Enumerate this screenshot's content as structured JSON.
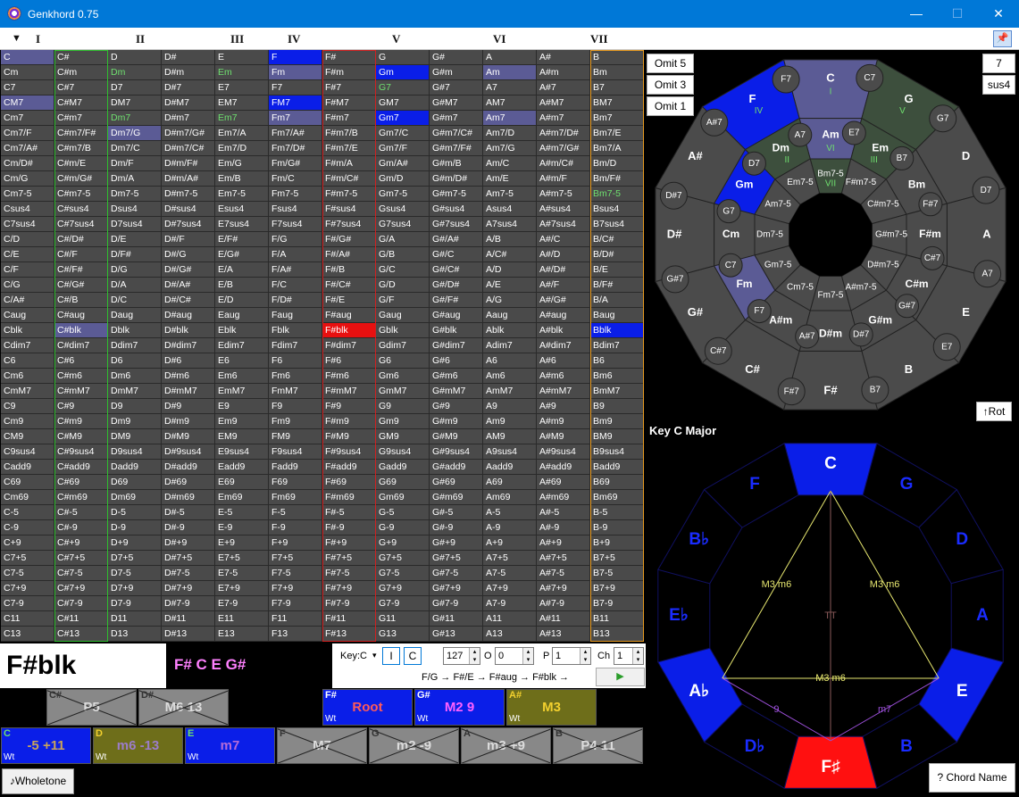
{
  "window": {
    "title": "Genkhord 0.75",
    "minimize": "—",
    "maximize": "☐",
    "close": "✕"
  },
  "toolbar": {
    "arrow": "▼",
    "numerals": [
      "I",
      "II",
      "III",
      "IV",
      "V",
      "VI",
      "VII"
    ],
    "pin": "📌"
  },
  "grid": {
    "roots": [
      "C",
      "C#",
      "D",
      "D#",
      "E",
      "F",
      "F#",
      "G",
      "G#",
      "A",
      "A#",
      "B"
    ],
    "suffixes": [
      "",
      "m",
      "7",
      "M7",
      "m7",
      "7/F",
      "m7/B",
      "m7/G",
      "m7/C",
      "m7/D",
      "m7-5",
      "sus4",
      "7sus4",
      "/D",
      "/E",
      "/F",
      "/G",
      "/B",
      "aug",
      "blk",
      "dim7",
      "6",
      "m6",
      "mM7",
      "9",
      "m9",
      "M9",
      "9sus4",
      "add9",
      "69",
      "m69",
      "-5",
      "-9",
      "+9",
      "7+5",
      "7-5",
      "7+9",
      "7-9",
      "11",
      "13"
    ],
    "cells": [
      [
        "C",
        "C#",
        "D",
        "D#",
        "E",
        "F",
        "F#",
        "G",
        "G#",
        "A",
        "A#",
        "B"
      ],
      [
        "Cm",
        "C#m",
        "Dm",
        "D#m",
        "Em",
        "Fm",
        "F#m",
        "Gm",
        "G#m",
        "Am",
        "A#m",
        "Bm"
      ],
      [
        "C7",
        "C#7",
        "D7",
        "D#7",
        "E7",
        "F7",
        "F#7",
        "G7",
        "G#7",
        "A7",
        "A#7",
        "B7"
      ],
      [
        "CM7",
        "C#M7",
        "DM7",
        "D#M7",
        "EM7",
        "FM7",
        "F#M7",
        "GM7",
        "G#M7",
        "AM7",
        "A#M7",
        "BM7"
      ],
      [
        "Cm7",
        "C#m7",
        "Dm7",
        "D#m7",
        "Em7",
        "Fm7",
        "F#m7",
        "Gm7",
        "G#m7",
        "Am7",
        "A#m7",
        "Bm7"
      ],
      [
        "Cm7/F",
        "C#m7/F#",
        "Dm7/G",
        "D#m7/G#",
        "Em7/A",
        "Fm7/A#",
        "F#m7/B",
        "Gm7/C",
        "G#m7/C#",
        "Am7/D",
        "A#m7/D#",
        "Bm7/E"
      ],
      [
        "Cm7/A#",
        "C#m7/B",
        "Dm7/C",
        "D#m7/C#",
        "Em7/D",
        "Fm7/D#",
        "F#m7/E",
        "Gm7/F",
        "G#m7/F#",
        "Am7/G",
        "A#m7/G#",
        "Bm7/A"
      ],
      [
        "Cm/D#",
        "C#m/E",
        "Dm/F",
        "D#m/F#",
        "Em/G",
        "Fm/G#",
        "F#m/A",
        "Gm/A#",
        "G#m/B",
        "Am/C",
        "A#m/C#",
        "Bm/D"
      ],
      [
        "Cm/G",
        "C#m/G#",
        "Dm/A",
        "D#m/A#",
        "Em/B",
        "Fm/C",
        "F#m/C#",
        "Gm/D",
        "G#m/D#",
        "Am/E",
        "A#m/F",
        "Bm/F#"
      ],
      [
        "Cm7-5",
        "C#m7-5",
        "Dm7-5",
        "D#m7-5",
        "Em7-5",
        "Fm7-5",
        "F#m7-5",
        "Gm7-5",
        "G#m7-5",
        "Am7-5",
        "A#m7-5",
        "Bm7-5"
      ],
      [
        "Csus4",
        "C#sus4",
        "Dsus4",
        "D#sus4",
        "Esus4",
        "Fsus4",
        "F#sus4",
        "Gsus4",
        "G#sus4",
        "Asus4",
        "A#sus4",
        "Bsus4"
      ],
      [
        "C7sus4",
        "C#7sus4",
        "D7sus4",
        "D#7sus4",
        "E7sus4",
        "F7sus4",
        "F#7sus4",
        "G7sus4",
        "G#7sus4",
        "A7sus4",
        "A#7sus4",
        "B7sus4"
      ],
      [
        "C/D",
        "C#/D#",
        "D/E",
        "D#/F",
        "E/F#",
        "F/G",
        "F#/G#",
        "G/A",
        "G#/A#",
        "A/B",
        "A#/C",
        "B/C#"
      ],
      [
        "C/E",
        "C#/F",
        "D/F#",
        "D#/G",
        "E/G#",
        "F/A",
        "F#/A#",
        "G/B",
        "G#/C",
        "A/C#",
        "A#/D",
        "B/D#"
      ],
      [
        "C/F",
        "C#/F#",
        "D/G",
        "D#/G#",
        "E/A",
        "F/A#",
        "F#/B",
        "G/C",
        "G#/C#",
        "A/D",
        "A#/D#",
        "B/E"
      ],
      [
        "C/G",
        "C#/G#",
        "D/A",
        "D#/A#",
        "E/B",
        "F/C",
        "F#/C#",
        "G/D",
        "G#/D#",
        "A/E",
        "A#/F",
        "B/F#"
      ],
      [
        "C/A#",
        "C#/B",
        "D/C",
        "D#/C#",
        "E/D",
        "F/D#",
        "F#/E",
        "G/F",
        "G#/F#",
        "A/G",
        "A#/G#",
        "B/A"
      ],
      [
        "Caug",
        "C#aug",
        "Daug",
        "D#aug",
        "Eaug",
        "Faug",
        "F#aug",
        "Gaug",
        "G#aug",
        "Aaug",
        "A#aug",
        "Baug"
      ],
      [
        "Cblk",
        "C#blk",
        "Dblk",
        "D#blk",
        "Eblk",
        "Fblk",
        "F#blk",
        "Gblk",
        "G#blk",
        "Ablk",
        "A#blk",
        "Bblk"
      ],
      [
        "Cdim7",
        "C#dim7",
        "Ddim7",
        "D#dim7",
        "Edim7",
        "Fdim7",
        "F#dim7",
        "Gdim7",
        "G#dim7",
        "Adim7",
        "A#dim7",
        "Bdim7"
      ],
      [
        "C6",
        "C#6",
        "D6",
        "D#6",
        "E6",
        "F6",
        "F#6",
        "G6",
        "G#6",
        "A6",
        "A#6",
        "B6"
      ],
      [
        "Cm6",
        "C#m6",
        "Dm6",
        "D#m6",
        "Em6",
        "Fm6",
        "F#m6",
        "Gm6",
        "G#m6",
        "Am6",
        "A#m6",
        "Bm6"
      ],
      [
        "CmM7",
        "C#mM7",
        "DmM7",
        "D#mM7",
        "EmM7",
        "FmM7",
        "F#mM7",
        "GmM7",
        "G#mM7",
        "AmM7",
        "A#mM7",
        "BmM7"
      ],
      [
        "C9",
        "C#9",
        "D9",
        "D#9",
        "E9",
        "F9",
        "F#9",
        "G9",
        "G#9",
        "A9",
        "A#9",
        "B9"
      ],
      [
        "Cm9",
        "C#m9",
        "Dm9",
        "D#m9",
        "Em9",
        "Fm9",
        "F#m9",
        "Gm9",
        "G#m9",
        "Am9",
        "A#m9",
        "Bm9"
      ],
      [
        "CM9",
        "C#M9",
        "DM9",
        "D#M9",
        "EM9",
        "FM9",
        "F#M9",
        "GM9",
        "G#M9",
        "AM9",
        "A#M9",
        "BM9"
      ],
      [
        "C9sus4",
        "C#9sus4",
        "D9sus4",
        "D#9sus4",
        "E9sus4",
        "F9sus4",
        "F#9sus4",
        "G9sus4",
        "G#9sus4",
        "A9sus4",
        "A#9sus4",
        "B9sus4"
      ],
      [
        "Cadd9",
        "C#add9",
        "Dadd9",
        "D#add9",
        "Eadd9",
        "Fadd9",
        "F#add9",
        "Gadd9",
        "G#add9",
        "Aadd9",
        "A#add9",
        "Badd9"
      ],
      [
        "C69",
        "C#69",
        "D69",
        "D#69",
        "E69",
        "F69",
        "F#69",
        "G69",
        "G#69",
        "A69",
        "A#69",
        "B69"
      ],
      [
        "Cm69",
        "C#m69",
        "Dm69",
        "D#m69",
        "Em69",
        "Fm69",
        "F#m69",
        "Gm69",
        "G#m69",
        "Am69",
        "A#m69",
        "Bm69"
      ],
      [
        "C-5",
        "C#-5",
        "D-5",
        "D#-5",
        "E-5",
        "F-5",
        "F#-5",
        "G-5",
        "G#-5",
        "A-5",
        "A#-5",
        "B-5"
      ],
      [
        "C-9",
        "C#-9",
        "D-9",
        "D#-9",
        "E-9",
        "F-9",
        "F#-9",
        "G-9",
        "G#-9",
        "A-9",
        "A#-9",
        "B-9"
      ],
      [
        "C+9",
        "C#+9",
        "D+9",
        "D#+9",
        "E+9",
        "F+9",
        "F#+9",
        "G+9",
        "G#+9",
        "A+9",
        "A#+9",
        "B+9"
      ],
      [
        "C7+5",
        "C#7+5",
        "D7+5",
        "D#7+5",
        "E7+5",
        "F7+5",
        "F#7+5",
        "G7+5",
        "G#7+5",
        "A7+5",
        "A#7+5",
        "B7+5"
      ],
      [
        "C7-5",
        "C#7-5",
        "D7-5",
        "D#7-5",
        "E7-5",
        "F7-5",
        "F#7-5",
        "G7-5",
        "G#7-5",
        "A7-5",
        "A#7-5",
        "B7-5"
      ],
      [
        "C7+9",
        "C#7+9",
        "D7+9",
        "D#7+9",
        "E7+9",
        "F7+9",
        "F#7+9",
        "G7+9",
        "G#7+9",
        "A7+9",
        "A#7+9",
        "B7+9"
      ],
      [
        "C7-9",
        "C#7-9",
        "D7-9",
        "D#7-9",
        "E7-9",
        "F7-9",
        "F#7-9",
        "G7-9",
        "G#7-9",
        "A7-9",
        "A#7-9",
        "B7-9"
      ],
      [
        "C11",
        "C#11",
        "D11",
        "D#11",
        "E11",
        "F11",
        "F#11",
        "G11",
        "G#11",
        "A11",
        "A#11",
        "B11"
      ],
      [
        "C13",
        "C#13",
        "D13",
        "D#13",
        "E13",
        "F13",
        "F#13",
        "G13",
        "G#13",
        "A13",
        "A#13",
        "B13"
      ]
    ],
    "highlights": {
      "0-0": "#5b5b95",
      "0-5": "#0a1ee8",
      "1-5": "#5b5b95",
      "1-7": "#0a1ee8",
      "1-9": "#5b5b95",
      "3-0": "#5b5b95",
      "3-5": "#0a1ee8",
      "4-5": "#5b5b95",
      "4-7": "#0a1ee8",
      "4-9": "#5b5b95",
      "5-2": "#5b5b95",
      "18-1": "#5b5b95",
      "18-6": "#e81010",
      "18-11": "#0a1ee8"
    },
    "greenText": [
      "1-2",
      "1-4",
      "2-7",
      "4-2",
      "4-4",
      "9-11"
    ],
    "colBorders": {
      "1": "#2ebd2e",
      "6": "#d02020",
      "11": "#e89a20"
    }
  },
  "selected": {
    "chord": "F#blk",
    "notes": "F# C E G#"
  },
  "controls": {
    "key_label": "Key:C",
    "key_arrow": "▾",
    "btn_I": "I",
    "btn_C": "C",
    "velocity": "127",
    "o_label": "O",
    "octave": "0",
    "p_label": "P",
    "program": "1",
    "ch_label": "Ch",
    "channel": "1",
    "progression": "F/G → F#/E → F#aug → F#blk →",
    "play": "▶"
  },
  "intervals_top": [
    {
      "note": "C#",
      "name": "P5",
      "wt": "",
      "color": "#888888",
      "crossed": true
    },
    {
      "note": "D#",
      "name": "M6 13",
      "wt": "",
      "color": "#888888",
      "crossed": true
    },
    {
      "note": "F#",
      "name": "Root",
      "wt": "Wt",
      "color": "#0a1ee8",
      "nameColor": "#ff5a5a"
    },
    {
      "note": "G#",
      "name": "M2 9",
      "wt": "Wt",
      "color": "#0a1ee8",
      "nameColor": "#ff60ff"
    },
    {
      "note": "A#",
      "name": "M3",
      "wt": "Wt",
      "color": "#6e6e1a",
      "nameColor": "#f2d02e"
    }
  ],
  "intervals_bottom": [
    {
      "note": "C",
      "name": "-5 +11",
      "wt": "Wt",
      "color": "#0a1ee8",
      "nameColor": "#c9a45a"
    },
    {
      "note": "D",
      "name": "m6 -13",
      "wt": "Wt",
      "color": "#6e6e1a",
      "nameColor": "#9b7dc8"
    },
    {
      "note": "E",
      "name": "m7",
      "wt": "Wt",
      "color": "#0a1ee8",
      "nameColor": "#b56bd8"
    },
    {
      "note": "F",
      "name": "M7",
      "wt": "",
      "color": "#888888",
      "crossed": true
    },
    {
      "note": "G",
      "name": "m2 -9",
      "wt": "",
      "color": "#888888",
      "crossed": true
    },
    {
      "note": "A",
      "name": "m3 +9",
      "wt": "",
      "color": "#888888",
      "crossed": true
    },
    {
      "note": "B",
      "name": "P4 11",
      "wt": "",
      "color": "#888888",
      "crossed": true
    }
  ],
  "wholetone_btn": "♪Wholetone",
  "side_buttons": {
    "omit5": "Omit 5",
    "omit3": "Omit 3",
    "omit1": "Omit 1",
    "seven": "7",
    "sus4": "sus4",
    "rot": "↑Rot",
    "chord_name": "? Chord Name"
  },
  "key_title": "Key C Major",
  "circle": {
    "outer": [
      "C",
      "G",
      "D",
      "A",
      "E",
      "B",
      "F#",
      "C#",
      "G#",
      "D#",
      "A#",
      "F"
    ],
    "mid": [
      "Am",
      "Em",
      "Bm",
      "F#m",
      "C#m",
      "G#m",
      "D#m",
      "A#m",
      "Fm",
      "Cm",
      "Gm",
      "Dm"
    ],
    "inner": [
      "Bm7-5",
      "F#m7-5",
      "C#m7-5",
      "G#m7-5",
      "D#m7-5",
      "A#m7-5",
      "Fm7-5",
      "Cm7-5",
      "Gm7-5",
      "Dm7-5",
      "Am7-5",
      "Em7-5"
    ],
    "outer_dom": [
      "C7",
      "G7",
      "D7",
      "A7",
      "E7",
      "B7",
      "F#7",
      "C#7",
      "G#7",
      "D#7",
      "A#7",
      "F7"
    ],
    "mid_dom": [
      "E7",
      "B7",
      "F#7",
      "C#7",
      "G#7",
      "D#7",
      "A#7",
      "F7",
      "C7",
      "G7",
      "D7",
      "A7"
    ],
    "outer_roman": {
      "0": "I",
      "1": "V",
      "11": "IV"
    },
    "mid_roman": {
      "0": "VI",
      "1": "III",
      "11": "II"
    },
    "inner_roman": {
      "0": "VII"
    },
    "outer_hl": {
      "0": "#5b5b95",
      "1": "#3d4f3d",
      "11": "#0a1ee8"
    },
    "mid_hl": {
      "0": "#5b5b95",
      "1": "#3d4f3d",
      "11": "#3d4f3d",
      "10": "#0a1ee8",
      "8": "#5b5b95"
    },
    "inner_hl": {
      "0": "#3d4f3d"
    }
  },
  "dodecagon": {
    "labels": [
      "C",
      "G",
      "D",
      "A",
      "E",
      "B",
      "F♯",
      "D♭",
      "A♭",
      "E♭",
      "B♭",
      "F"
    ],
    "filled": {
      "0": "#0a1ee8",
      "4": "#0a1ee8",
      "6": "#ff1010",
      "8": "#0a1ee8"
    },
    "lines": [
      {
        "a": 0,
        "b": 8,
        "label": "M3  m6",
        "color": "#e8e870"
      },
      {
        "a": 0,
        "b": 4,
        "label": "M3  m6",
        "color": "#e8e870"
      },
      {
        "a": 8,
        "b": 4,
        "label": "M3  m6",
        "color": "#e8e870"
      },
      {
        "a": 0,
        "b": 6,
        "label": "TT",
        "color": "#8a5a5a"
      },
      {
        "a": 8,
        "b": 6,
        "label": "9",
        "color": "#9b4fd8"
      },
      {
        "a": 4,
        "b": 6,
        "label": "m7",
        "color": "#9b4fd8"
      }
    ]
  }
}
